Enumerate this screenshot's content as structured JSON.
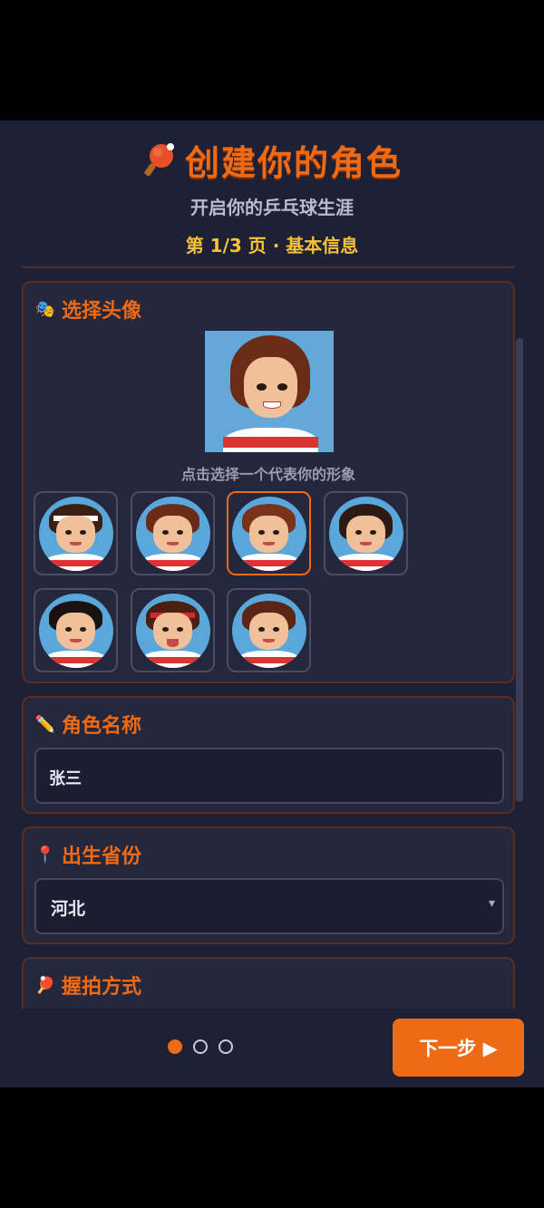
{
  "header": {
    "title": "创建你的角色",
    "subtitle": "开启你的乒乓球生涯",
    "page_indicator": "第 1/3 页 · 基本信息"
  },
  "avatar_section": {
    "icon": "masks-icon",
    "title": "选择头像",
    "hint": "点击选择一个代表你的形象",
    "selected_index": 2,
    "options_count": 7
  },
  "name_section": {
    "icon": "pencil-icon",
    "title": "角色名称",
    "value": "张三"
  },
  "province_section": {
    "icon": "pin-icon",
    "title": "出生省份",
    "value": "河北"
  },
  "grip_section": {
    "icon": "paddle-icon",
    "title": "握拍方式"
  },
  "footer": {
    "next_label": "下一步 ▶",
    "current_page": 1,
    "total_pages": 3
  },
  "colors": {
    "accent": "#ee6a14",
    "highlight": "#f5c23a",
    "background": "#1e2035",
    "card": "#25273d",
    "card_border": "#5a2f22"
  }
}
